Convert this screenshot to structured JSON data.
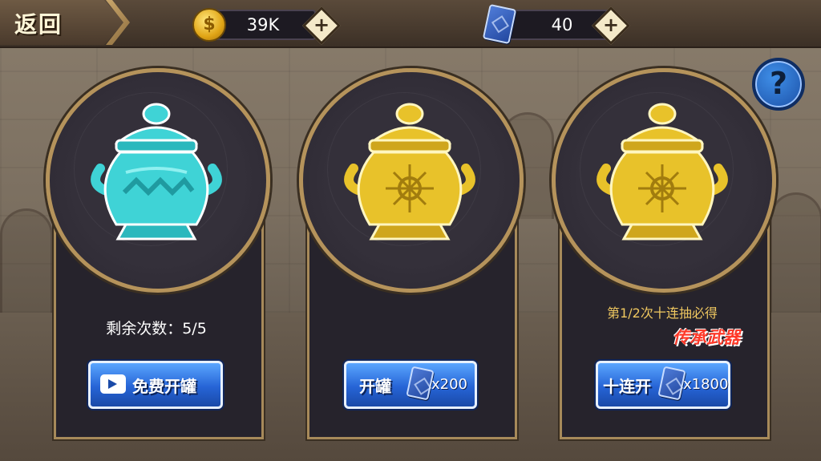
{
  "header": {
    "back_label": "返回",
    "gold": {
      "value": "39K",
      "icon": "coin-icon",
      "coin_symbol": "$"
    },
    "cards": {
      "value": "40",
      "icon": "card-icon"
    },
    "plus_symbol": "+"
  },
  "help": {
    "icon": "help-icon",
    "symbol": "?"
  },
  "panels": [
    {
      "jar": "teal-jar",
      "remaining_label": "剩余次数：5/5",
      "button_label": "免费开罐",
      "button_icon": "video-icon"
    },
    {
      "jar": "gold-jar",
      "button_label": "开罐",
      "button_cost": "x200",
      "button_icon": "card-icon"
    },
    {
      "jar": "gold-jar",
      "promo_line1": "第1/2次十连抽必得",
      "promo_line2": "传承武器",
      "button_label": "十连开",
      "button_cost": "x1800",
      "button_icon": "card-icon"
    }
  ],
  "colors": {
    "teal_jar": "#3fd3d6",
    "gold_jar": "#e8c22a",
    "button_blue": "#2664d6",
    "promo_yellow": "#f0c860",
    "promo_red": "#ff3a2a"
  }
}
